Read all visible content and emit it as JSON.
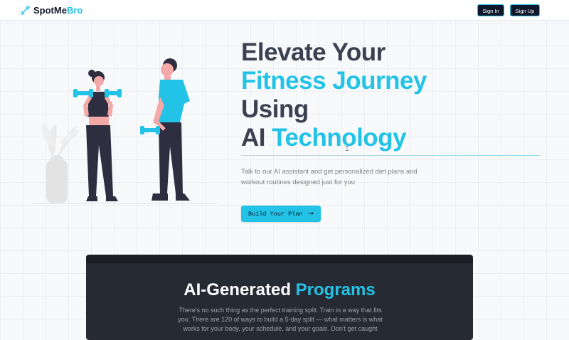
{
  "navbar": {
    "logo_icon": "dumbbell-icon",
    "logo_part1": "SpotMe",
    "logo_part2": "Bro",
    "sign_in": "Sign In",
    "sign_up": "Sign Up"
  },
  "hero": {
    "title_line1": "Elevate Your",
    "title_line2": "Fitness Journey",
    "title_line3": "Using",
    "title_line4a": "AI",
    "title_line4b": "Technology",
    "subtitle": "Talk to our AI assistant and get personalized diet plans and workout routines designed just for you",
    "cta_label": "Build Your Plan",
    "cta_icon": "arrow-right-icon"
  },
  "programs": {
    "title_a": "AI-Generated",
    "title_b": "Programs",
    "body": "There's no such thing as the perfect training split. Train in a way that fits you. There are 120 of ways to build a 5-day split — what matters is what works for your body, your schedule, and your goals. Don't get caught"
  },
  "colors": {
    "accent": "#22c3e6",
    "dark": "#0f172a",
    "heading": "#3b4151",
    "section_bg": "#262b33"
  }
}
